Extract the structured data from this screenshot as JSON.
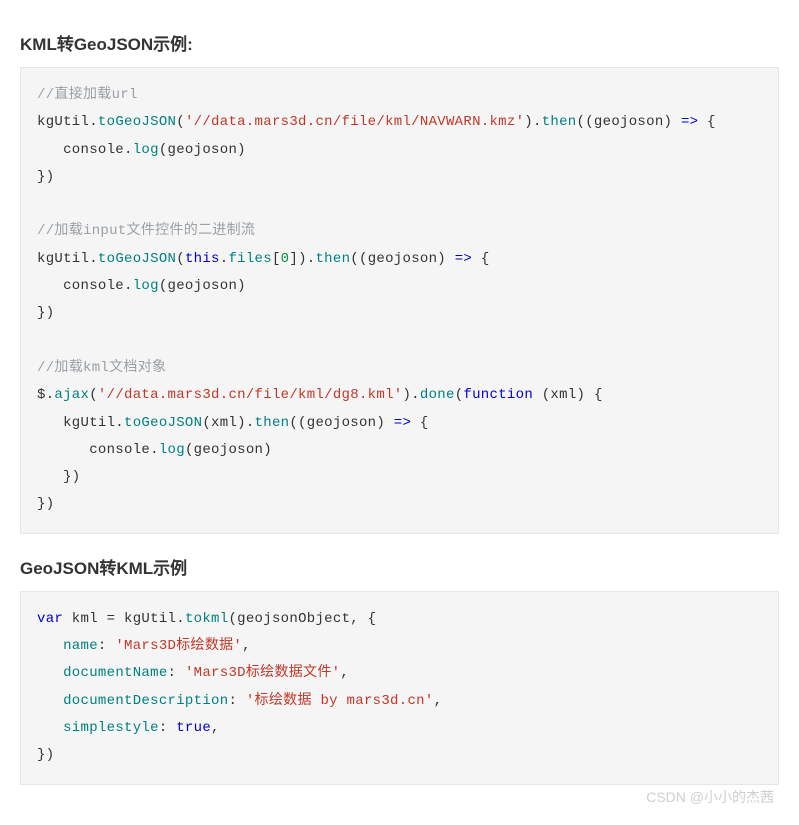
{
  "sections": [
    {
      "heading": "KML转GeoJSON示例:",
      "code_tokens": [
        {
          "cls": "tok-comment",
          "t": "//直接加载url"
        },
        {
          "t": "\n"
        },
        {
          "t": "kgUtil."
        },
        {
          "cls": "tok-func",
          "t": "toGeoJSON"
        },
        {
          "t": "("
        },
        {
          "cls": "tok-string",
          "t": "'//data.mars3d.cn/file/kml/NAVWARN.kmz'"
        },
        {
          "t": ")."
        },
        {
          "cls": "tok-func",
          "t": "then"
        },
        {
          "t": "((geojoson) "
        },
        {
          "cls": "tok-keyword",
          "t": "=>"
        },
        {
          "t": " {"
        },
        {
          "t": "\n   console."
        },
        {
          "cls": "tok-func",
          "t": "log"
        },
        {
          "t": "(geojoson)"
        },
        {
          "t": "\n})"
        },
        {
          "t": "\n"
        },
        {
          "t": "\n"
        },
        {
          "cls": "tok-comment",
          "t": "//加载input文件控件的二进制流"
        },
        {
          "t": "\n"
        },
        {
          "t": "kgUtil."
        },
        {
          "cls": "tok-func",
          "t": "toGeoJSON"
        },
        {
          "t": "("
        },
        {
          "cls": "tok-keyword",
          "t": "this"
        },
        {
          "t": "."
        },
        {
          "cls": "tok-prop",
          "t": "files"
        },
        {
          "t": "["
        },
        {
          "cls": "tok-number",
          "t": "0"
        },
        {
          "t": "])."
        },
        {
          "cls": "tok-func",
          "t": "then"
        },
        {
          "t": "((geojoson) "
        },
        {
          "cls": "tok-keyword",
          "t": "=>"
        },
        {
          "t": " {"
        },
        {
          "t": "\n   console."
        },
        {
          "cls": "tok-func",
          "t": "log"
        },
        {
          "t": "(geojoson)"
        },
        {
          "t": "\n})"
        },
        {
          "t": "\n"
        },
        {
          "t": "\n"
        },
        {
          "cls": "tok-comment",
          "t": "//加载kml文档对象"
        },
        {
          "t": "\n"
        },
        {
          "t": "$."
        },
        {
          "cls": "tok-func",
          "t": "ajax"
        },
        {
          "t": "("
        },
        {
          "cls": "tok-string",
          "t": "'//data.mars3d.cn/file/kml/dg8.kml'"
        },
        {
          "t": ")."
        },
        {
          "cls": "tok-func",
          "t": "done"
        },
        {
          "t": "("
        },
        {
          "cls": "tok-keyword",
          "t": "function"
        },
        {
          "t": " (xml) {"
        },
        {
          "t": "\n   kgUtil."
        },
        {
          "cls": "tok-func",
          "t": "toGeoJSON"
        },
        {
          "t": "(xml)."
        },
        {
          "cls": "tok-func",
          "t": "then"
        },
        {
          "t": "((geojoson) "
        },
        {
          "cls": "tok-keyword",
          "t": "=>"
        },
        {
          "t": " {"
        },
        {
          "t": "\n      console."
        },
        {
          "cls": "tok-func",
          "t": "log"
        },
        {
          "t": "(geojoson)"
        },
        {
          "t": "\n   })"
        },
        {
          "t": "\n})"
        }
      ]
    },
    {
      "heading": "GeoJSON转KML示例",
      "code_tokens": [
        {
          "cls": "tok-keyword",
          "t": "var"
        },
        {
          "t": " kml = kgUtil."
        },
        {
          "cls": "tok-func",
          "t": "tokml"
        },
        {
          "t": "(geojsonObject, {"
        },
        {
          "t": "\n   "
        },
        {
          "cls": "tok-prop",
          "t": "name"
        },
        {
          "t": ": "
        },
        {
          "cls": "tok-string",
          "t": "'Mars3D标绘数据'"
        },
        {
          "t": ","
        },
        {
          "t": "\n   "
        },
        {
          "cls": "tok-prop",
          "t": "documentName"
        },
        {
          "t": ": "
        },
        {
          "cls": "tok-string",
          "t": "'Mars3D标绘数据文件'"
        },
        {
          "t": ","
        },
        {
          "t": "\n   "
        },
        {
          "cls": "tok-prop",
          "t": "documentDescription"
        },
        {
          "t": ": "
        },
        {
          "cls": "tok-string",
          "t": "'标绘数据 by mars3d.cn'"
        },
        {
          "t": ","
        },
        {
          "t": "\n   "
        },
        {
          "cls": "tok-prop",
          "t": "simplestyle"
        },
        {
          "t": ": "
        },
        {
          "cls": "tok-keyword",
          "t": "true"
        },
        {
          "t": ","
        },
        {
          "t": "\n})"
        }
      ]
    }
  ],
  "watermark": "CSDN @小小的杰茜"
}
